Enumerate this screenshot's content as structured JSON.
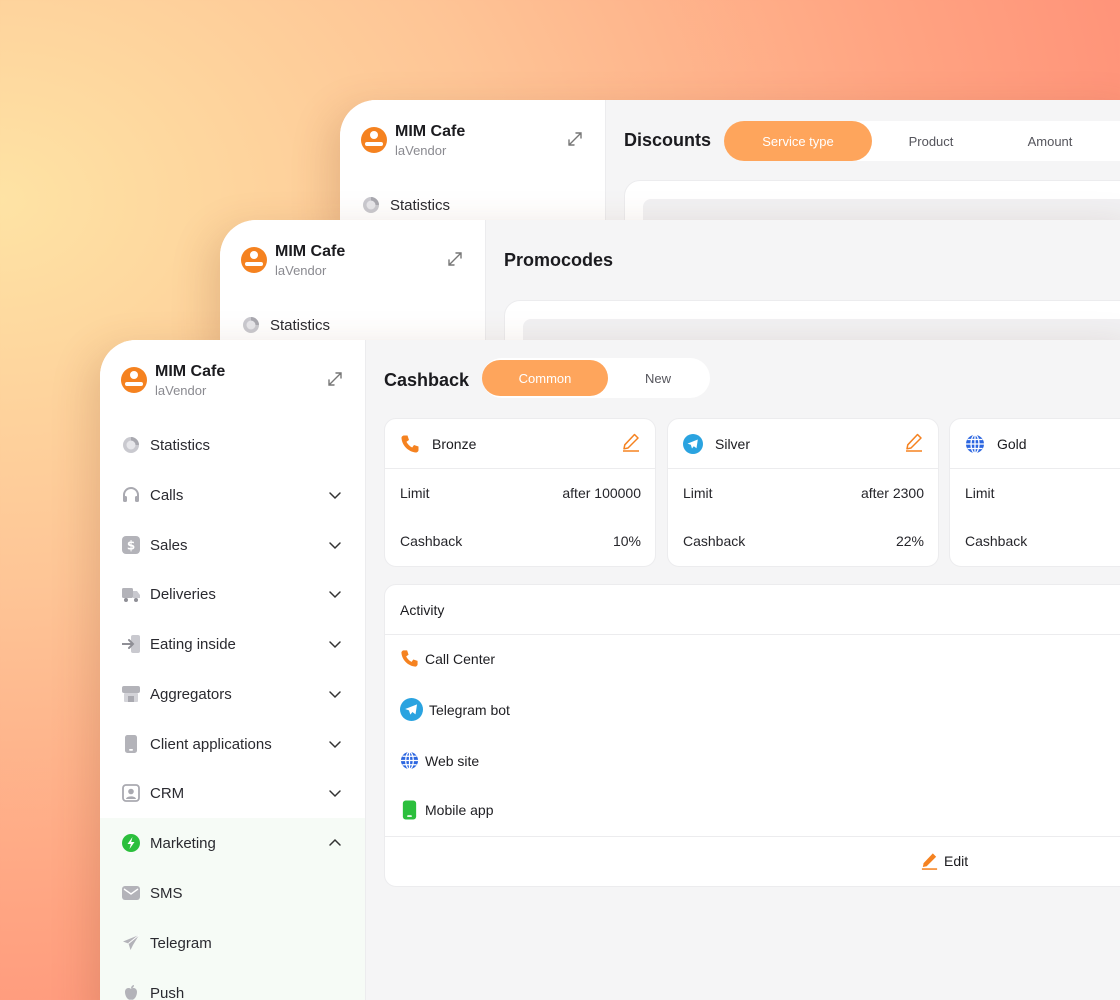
{
  "brand": {
    "title": "MIM Cafe",
    "subtitle": "laVendor"
  },
  "back_window": {
    "title": "Discounts",
    "tabs": [
      "Service type",
      "Product",
      "Amount"
    ],
    "sidebar_first": "Statistics"
  },
  "mid_window": {
    "title": "Promocodes",
    "sidebar_first": "Statistics"
  },
  "front_window": {
    "title": "Cashback",
    "tabs": [
      "Common",
      "New"
    ],
    "sidebar": [
      {
        "label": "Statistics",
        "icon": "statistics-icon"
      },
      {
        "label": "Calls",
        "icon": "headphones-icon"
      },
      {
        "label": "Sales",
        "icon": "dollar-icon"
      },
      {
        "label": "Deliveries",
        "icon": "truck-icon"
      },
      {
        "label": "Eating inside",
        "icon": "enter-icon"
      },
      {
        "label": "Aggregators",
        "icon": "store-icon"
      },
      {
        "label": "Client applications",
        "icon": "phone-icon"
      },
      {
        "label": "CRM",
        "icon": "user-card-icon"
      },
      {
        "label": "Marketing",
        "icon": "bolt-icon"
      },
      {
        "label": "SMS",
        "icon": "mail-icon"
      },
      {
        "label": "Telegram",
        "icon": "paper-plane-icon"
      },
      {
        "label": "Push",
        "icon": "apple-icon"
      }
    ],
    "tiers": [
      {
        "name": "Bronze",
        "icon": "phone-call-icon",
        "limit_label": "Limit",
        "limit_value": "after 100000",
        "cashback_label": "Cashback",
        "cashback_value": "10%"
      },
      {
        "name": "Silver",
        "icon": "telegram-icon",
        "limit_label": "Limit",
        "limit_value": "after 2300",
        "cashback_label": "Cashback",
        "cashback_value": "22%"
      },
      {
        "name": "Gold",
        "icon": "globe-icon",
        "limit_label": "Limit",
        "limit_value": "",
        "cashback_label": "Cashback",
        "cashback_value": ""
      }
    ],
    "activity": {
      "title": "Activity",
      "items": [
        "Call Center",
        "Telegram bot",
        "Web site",
        "Mobile app"
      ],
      "edit_label": "Edit"
    }
  },
  "colors": {
    "accent": "#fea55c",
    "orange": "#f58220",
    "green": "#2bbf3c",
    "telegram": "#2aa3e0",
    "globe": "#2c66e0"
  }
}
